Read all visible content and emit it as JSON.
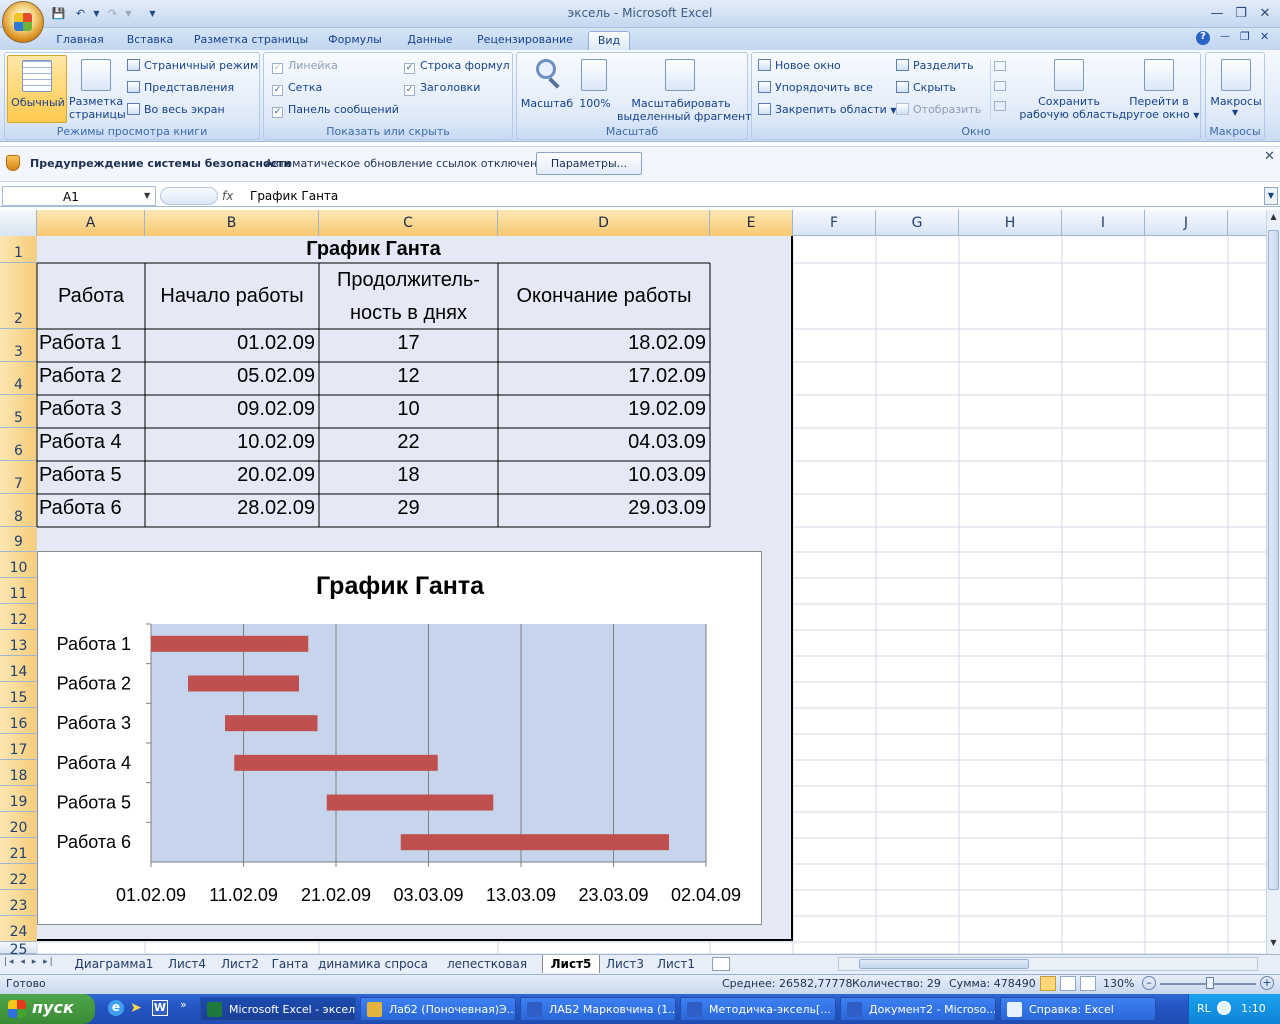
{
  "window": {
    "title": "эксель - Microsoft Excel"
  },
  "ribbon_tabs": [
    "Главная",
    "Вставка",
    "Разметка страницы",
    "Формулы",
    "Данные",
    "Рецензирование",
    "Вид"
  ],
  "ribbon": {
    "views": {
      "normal": "Обычный",
      "page_layout_1": "Разметка",
      "page_layout_2": "страницы",
      "page_mode": "Страничный режим",
      "presentations": "Представления",
      "fullscreen": "Во весь экран",
      "label": "Режимы просмотра книги"
    },
    "show": {
      "ruler": "Линейка",
      "formula_bar": "Строка формул",
      "grid": "Сетка",
      "headings": "Заголовки",
      "message_bar": "Панель сообщений",
      "label": "Показать или скрыть"
    },
    "zoom": {
      "zoom": "Масштаб",
      "hundred": "100%",
      "sel_1": "Масштабировать",
      "sel_2": "выделенный фрагмент",
      "label": "Масштаб"
    },
    "window": {
      "new": "Новое окно",
      "arrange": "Упорядочить все",
      "freeze": "Закрепить области",
      "split": "Разделить",
      "hide": "Скрыть",
      "unhide": "Отобразить",
      "save_1": "Сохранить",
      "save_2": "рабочую область",
      "switch_1": "Перейти в",
      "switch_2": "другое окно",
      "label": "Окно"
    },
    "macros": {
      "btn": "Макросы",
      "label": "Макросы"
    }
  },
  "security": {
    "title": "Предупреждение системы безопасности",
    "msg": "Автоматическое обновление ссылок отключено",
    "button": "Параметры..."
  },
  "formula_bar": {
    "name": "A1",
    "fx": "fx",
    "value": "График Ганта"
  },
  "columns": [
    "A",
    "B",
    "C",
    "D",
    "E",
    "F",
    "G",
    "H",
    "I",
    "J"
  ],
  "rows": [
    "1",
    "2",
    "3",
    "4",
    "5",
    "6",
    "7",
    "8",
    "9",
    "10",
    "11",
    "12",
    "13",
    "14",
    "15",
    "16",
    "17",
    "18",
    "19",
    "20",
    "21",
    "22",
    "23",
    "24",
    "25"
  ],
  "table": {
    "title": "График Ганта",
    "headers": {
      "work": "Работа",
      "start": "Начало работы",
      "dur_1": "Продолжитель-",
      "dur_2": "ность в днях",
      "end": "Окончание работы"
    },
    "rows": [
      [
        "Работа 1",
        "01.02.09",
        "17",
        "18.02.09"
      ],
      [
        "Работа 2",
        "05.02.09",
        "12",
        "17.02.09"
      ],
      [
        "Работа 3",
        "09.02.09",
        "10",
        "19.02.09"
      ],
      [
        "Работа 4",
        "10.02.09",
        "22",
        "04.03.09"
      ],
      [
        "Работа 5",
        "20.02.09",
        "18",
        "10.03.09"
      ],
      [
        "Работа 6",
        "28.02.09",
        "29",
        "29.03.09"
      ]
    ]
  },
  "chart_data": {
    "type": "bar",
    "title": "График Ганта",
    "categories": [
      "Работа 1",
      "Работа 2",
      "Работа 3",
      "Работа 4",
      "Работа 5",
      "Работа 6"
    ],
    "start": [
      "01.02.09",
      "05.02.09",
      "09.02.09",
      "10.02.09",
      "20.02.09",
      "28.02.09"
    ],
    "duration_days": [
      17,
      12,
      10,
      22,
      18,
      29
    ],
    "x_ticks": [
      "01.02.09",
      "11.02.09",
      "21.02.09",
      "03.03.09",
      "13.03.09",
      "23.03.09",
      "02.04.09"
    ],
    "xlim": [
      "01.02.09",
      "02.04.09"
    ],
    "bar_color": "#c0504d",
    "plot_bg": "#c6d5ec",
    "grid": true,
    "legend": "none"
  },
  "sheet_tabs": [
    "Диаграмма1",
    "Лист4",
    "Лист2",
    "Ганта",
    "динамика спроса",
    "лепестковая",
    "Лист5",
    "Лист3",
    "Лист1"
  ],
  "active_sheet": "Лист5",
  "status": {
    "ready": "Готово",
    "avg": "Среднее: 26582,77778",
    "count": "Количество: 29",
    "sum": "Сумма: 478490",
    "zoom": "130%"
  },
  "taskbar": {
    "start": "пуск",
    "items": [
      "Microsoft Excel - эксель",
      "Лаб2 (Поночевная)Э...",
      "ЛАБ2 Марковчина (1...",
      "Методичка-эксель[...",
      "Документ2 - Microso...",
      "Справка: Excel"
    ],
    "lang": "RL",
    "time": "1:10"
  }
}
